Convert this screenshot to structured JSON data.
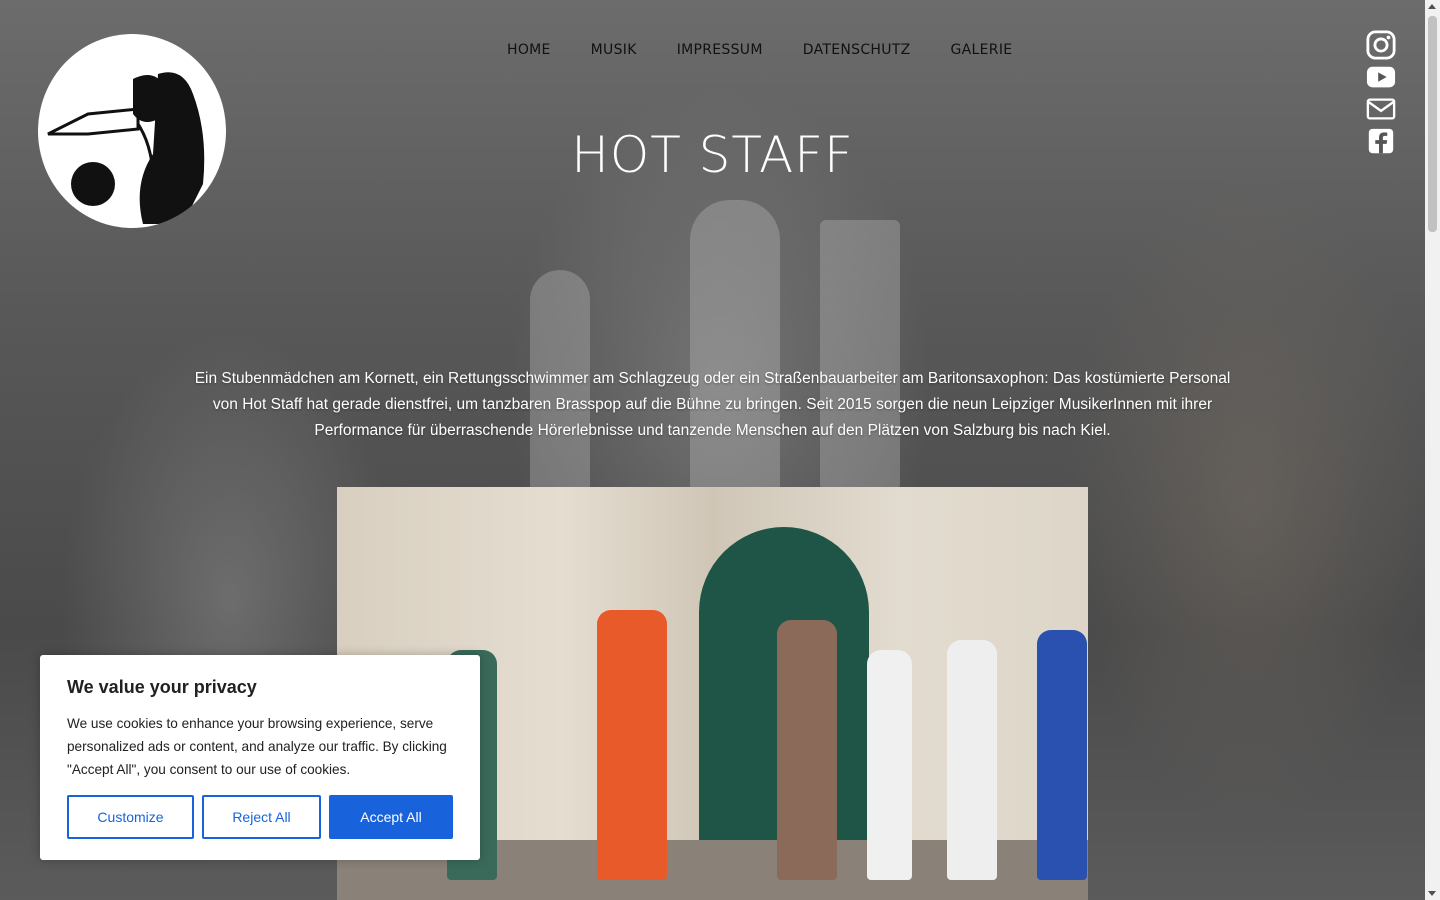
{
  "nav": {
    "items": [
      "HOME",
      "MUSIK",
      "IMPRESSUM",
      "DATENSCHUTZ",
      "GALERIE"
    ]
  },
  "hero": {
    "title": "HOT STAFF",
    "intro": "Ein Stubenmädchen am Kornett, ein Rettungsschwimmer am Schlagzeug oder ein Straßenbauarbeiter am Baritonsaxophon: Das kostümierte Personal von Hot Staff hat gerade dienstfrei, um tanzbaren Brasspop auf die Bühne zu bringen. Seit 2015 sorgen die neun Leipziger MusikerInnen mit ihrer Performance für überraschende Hörerlebnisse und tanzende Menschen auf den Plätzen von Salzburg bis nach Kiel."
  },
  "social": [
    "instagram-icon",
    "youtube-icon",
    "mail-icon",
    "facebook-icon"
  ],
  "cookie": {
    "title": "We value your privacy",
    "text": "We use cookies to enhance your browsing experience, serve personalized ads or content, and analyze our traffic. By clicking \"Accept All\", you consent to our use of cookies.",
    "customize_label": "Customize",
    "reject_label": "Reject All",
    "accept_label": "Accept All",
    "accent_color": "#1863dc"
  }
}
